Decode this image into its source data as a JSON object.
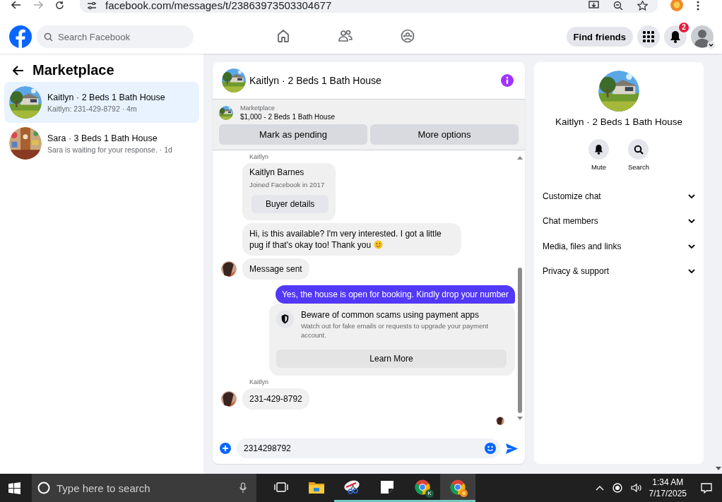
{
  "browser": {
    "url": "facebook.com/messages/t/23863973503304677"
  },
  "header": {
    "search": {
      "placeholder": "Search Facebook"
    },
    "nav": [
      {
        "kind": "home",
        "selected": false
      },
      {
        "kind": "friends",
        "selected": false
      },
      {
        "kind": "groups",
        "selected": false
      }
    ],
    "find_friends": "Find friends",
    "notification_count": "2"
  },
  "sidebar": {
    "title": "Marketplace",
    "conversations": [
      {
        "title": "Kaitlyn · 2 Beds 1 Bath House",
        "preview": "Kaitlyn: 231-429-8792 · 4m",
        "selected": true
      },
      {
        "title": "Sara · 3 Beds 1 Bath House",
        "preview": "Sara is waiting for your response. · 1d",
        "selected": false
      }
    ]
  },
  "chat": {
    "title": "Kaitlyn · 2 Beds 1 Bath House",
    "listing": {
      "source": "Marketplace",
      "title": "$1,000 - 2 Beds 1 Bath House"
    },
    "actions": [
      "Mark as pending",
      "More options"
    ],
    "messages": [
      {
        "kind": "sender",
        "text": "Kaitlyn"
      },
      {
        "kind": "profile",
        "name": "Kaitlyn Barnes",
        "subtitle": "Joined Facebook in 2017",
        "button": "Buyer details"
      },
      {
        "kind": "incoming",
        "text": "Hi, is this available? I'm very interested. I got a little pug if that's okay too! Thank you",
        "emoji": true,
        "avatar": false
      },
      {
        "kind": "incoming",
        "text": "Message sent",
        "emoji": false,
        "avatar": true
      },
      {
        "kind": "outgoing",
        "text": "Yes, the house is open for booking. Kindly drop your number"
      },
      {
        "kind": "notice",
        "title": "Beware of common scams using payment apps",
        "body": "Watch out for fake emails or requests to upgrade your payment account.",
        "button": "Learn More"
      },
      {
        "kind": "sender",
        "text": "Kaitlyn"
      },
      {
        "kind": "incoming",
        "text": "231-429-8792",
        "emoji": false,
        "avatar": true
      },
      {
        "kind": "seen"
      }
    ],
    "composer": {
      "value": "2314298792"
    }
  },
  "details": {
    "title": "Kaitlyn · 2 Beds 1 Bath House",
    "actions": [
      {
        "kind": "mute",
        "label": "Mute"
      },
      {
        "kind": "search",
        "label": "Search"
      }
    ],
    "sections": [
      {
        "label": "Customize chat",
        "expanded": false
      },
      {
        "label": "Chat members",
        "expanded": false
      },
      {
        "label": "Media, files and links",
        "expanded": false
      },
      {
        "label": "Privacy & support",
        "expanded": false
      }
    ]
  },
  "taskbar": {
    "search": {
      "placeholder": "Type here to search"
    },
    "apps": [
      {
        "kind": "task-view",
        "running": false,
        "selected": false
      },
      {
        "kind": "folder",
        "running": false,
        "selected": false
      },
      {
        "kind": "snipping",
        "running": true,
        "selected": false
      },
      {
        "kind": "sticky",
        "running": true,
        "selected": false
      },
      {
        "kind": "chrome",
        "badge": "K",
        "running": true,
        "selected": false
      },
      {
        "kind": "chrome",
        "running": true,
        "selected": true
      }
    ],
    "time": "1:34 AM",
    "date": "7/17/2025"
  }
}
